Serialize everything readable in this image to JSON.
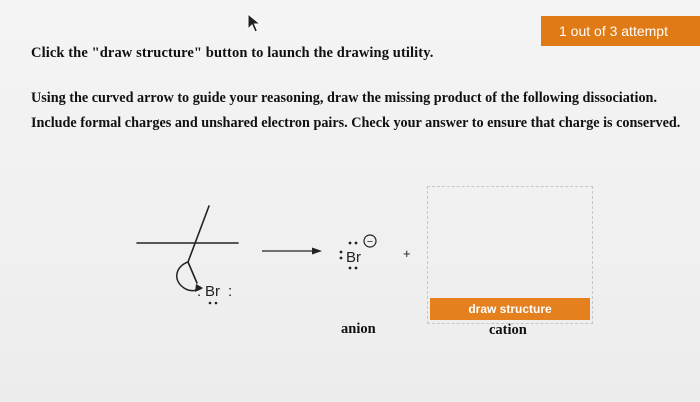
{
  "header": {
    "attempts_text": "1 out of 3 attempt"
  },
  "instructions": {
    "line1": "Click the \"draw structure\" button to launch the drawing utility.",
    "line2": "Using the curved arrow to guide your reasoning, draw the missing product of the following dissociation. Include formal charges and unshared electron pairs. Check your answer to ensure that charge is conserved."
  },
  "reaction": {
    "reactant_atom": "Br",
    "reactant_lone_pair_marks": ":",
    "anion_symbol": "Br",
    "anion_charge": "−",
    "plus_sign": "+",
    "anion_label": "anion",
    "cation_label": "cation"
  },
  "answer_area": {
    "draw_button_label": "draw structure"
  },
  "colors": {
    "accent": "#e07a14",
    "button": "#e4801e"
  }
}
